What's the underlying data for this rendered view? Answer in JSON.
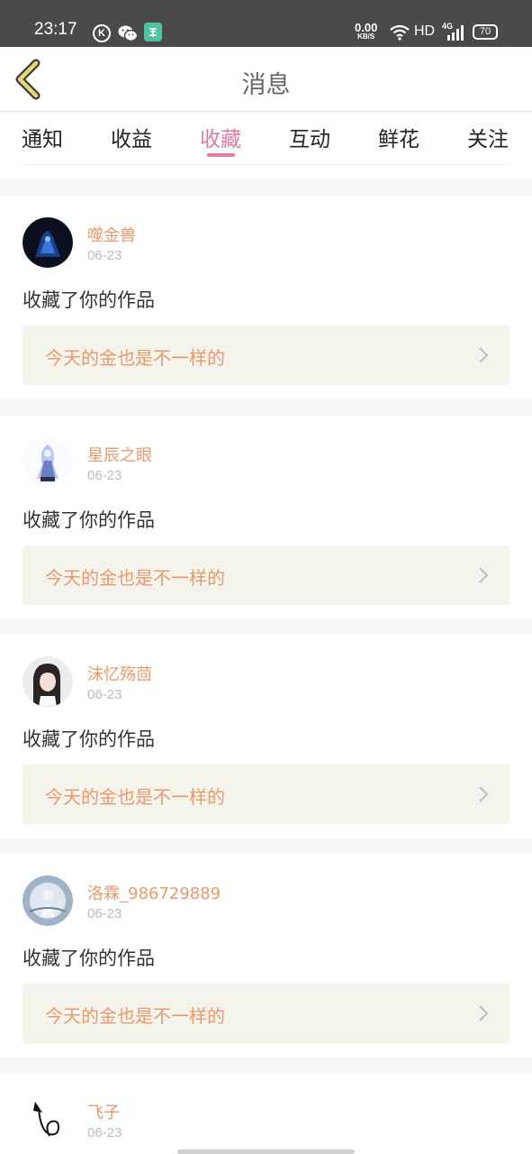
{
  "status_bar": {
    "time": "23:17",
    "speed_value": "0.00",
    "speed_unit": "KB/S",
    "network": "HD",
    "network_gen": "4G",
    "battery": "70"
  },
  "header": {
    "title": "消息"
  },
  "tabs": [
    {
      "label": "通知"
    },
    {
      "label": "收益"
    },
    {
      "label": "收藏"
    },
    {
      "label": "互动"
    },
    {
      "label": "鲜花"
    },
    {
      "label": "关注"
    }
  ],
  "active_tab": "收藏",
  "colors": {
    "accent_pink": "#e27aa3",
    "name_orange": "#e89a6e",
    "work_box_bg": "#f5f4ec"
  },
  "items": [
    {
      "username": "噬金兽",
      "date": "06-23",
      "action": "收藏了你的作品",
      "work_title": "今天的金也是不一样的"
    },
    {
      "username": "星辰之眼",
      "date": "06-23",
      "action": "收藏了你的作品",
      "work_title": "今天的金也是不一样的"
    },
    {
      "username": "沫忆殇茴",
      "date": "06-23",
      "action": "收藏了你的作品",
      "work_title": "今天的金也是不一样的"
    },
    {
      "username": "洛霖_986729889",
      "date": "06-23",
      "action": "收藏了你的作品",
      "work_title": "今天的金也是不一样的"
    },
    {
      "username": "飞子",
      "date": "06-23"
    }
  ]
}
